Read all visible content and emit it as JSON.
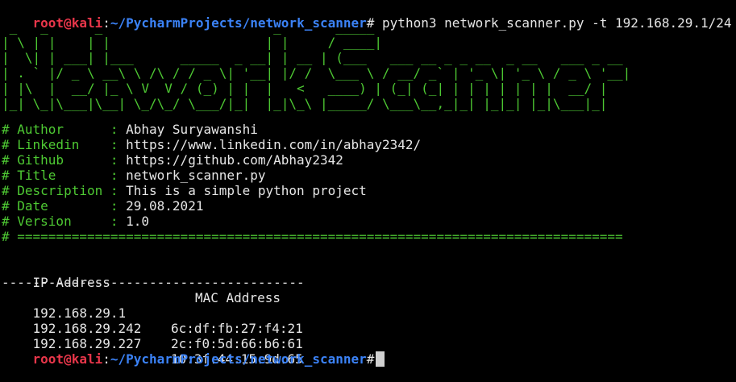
{
  "prompt": {
    "user_host": "root@kali",
    "separator": ":",
    "path": "~/PycharmProjects/network_scanner",
    "symbol": "#"
  },
  "command": " python3 network_scanner.py -t 192.168.29.1/24",
  "banner_art": " _   _      _                      _       _____                                          \n| \\ | |    | |                    | |     / ____|                                         \n|  \\| | ___| |___      _____  _ __| | __ | (___   ___ __ _ _ __  _ __   ___ _ __ \n| . ` |/ _ \\ __\\ \\ /\\ / / _ \\| '__| |/ /  \\___ \\ / __/ _` | '_ \\| '_ \\ / _ \\ '__|\n| |\\  |  __/ |_ \\ V  V / (_) | |  |   <   ____) | (_| (_| | | | | | | |  __/ |   \n|_| \\_|\\___|\\__| \\_/\\_/ \\___/|_|  |_|\\_\\ |_____/ \\___\\__,_|_| |_|_| |_|\\___|_|   ",
  "info": [
    {
      "label": "# Author      : ",
      "value": "Abhay Suryawanshi"
    },
    {
      "label": "# Linkedin    : ",
      "value": "https://www.linkedin.com/in/abhay2342/"
    },
    {
      "label": "# Github      : ",
      "value": "https://github.com/Abhay2342"
    },
    {
      "label": "# Title       : ",
      "value": "network_scanner.py"
    },
    {
      "label": "# Description : ",
      "value": "This is a simple python project"
    },
    {
      "label": "# Date        : ",
      "value": "29.08.2021"
    },
    {
      "label": "# Version     : ",
      "value": "1.0"
    }
  ],
  "rule": "# ==============================================================================",
  "table": {
    "header_ip": "IP Address",
    "header_mac": "MAC Address",
    "divider": "---------------------------------------",
    "rows": [
      {
        "ip": "192.168.29.1",
        "mac": "6c:df:fb:27:f4:21"
      },
      {
        "ip": "192.168.29.242",
        "mac": "2c:f0:5d:66:b6:61"
      },
      {
        "ip": "192.168.29.227",
        "mac": "10:3f:44:15:9d:65"
      }
    ]
  },
  "colors": {
    "background": "#000000",
    "user": "#e8364a",
    "path": "#3b82f6",
    "banner": "#4ec933",
    "text": "#e6e6e6"
  }
}
